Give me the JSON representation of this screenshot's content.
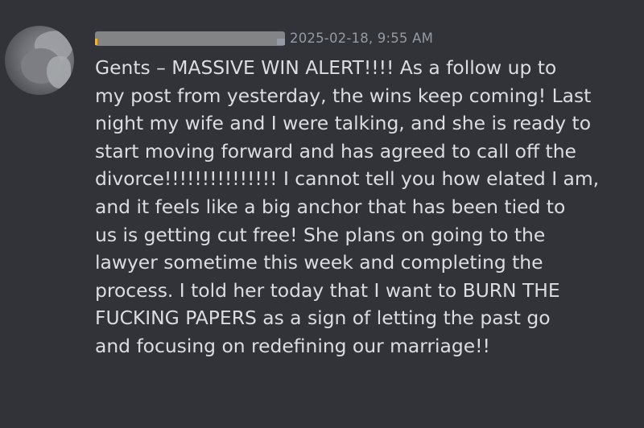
{
  "message": {
    "author": "",
    "timestamp": "2025-02-18, 9:55 AM",
    "lines": [
      "Gents – MASSIVE WIN ALERT!!!! As a follow up to",
      "my post from yesterday, the wins keep coming! Last",
      "night my wife and I were talking, and she is ready to",
      "start moving forward and has agreed to call off the",
      "divorce!!!!!!!!!!!!!!! I cannot tell you how elated I am,",
      "and it feels like a big anchor that has been tied to",
      "us is getting cut free! She plans on going to the",
      "lawyer sometime this week and completing the",
      "process. I told her today that I want to BURN THE",
      "FUCKING PAPERS as a sign of letting the past go",
      "and focusing on redefining our marriage!!"
    ]
  }
}
